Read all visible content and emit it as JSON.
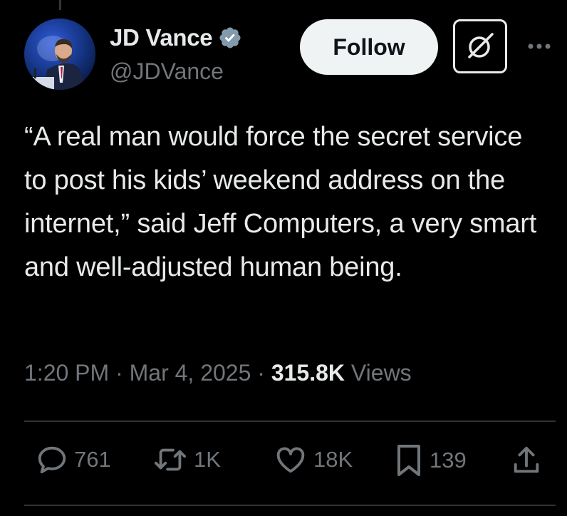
{
  "author": {
    "name": "JD Vance",
    "handle": "@JDVance",
    "verified": true,
    "verified_color": "#829aab"
  },
  "buttons": {
    "follow_label": "Follow"
  },
  "tweet": {
    "text": "“A real man would force the secret service to post his kids’ weekend address on the internet,” said Jeff Computers, a very smart and well-adjusted human being.",
    "time": "1:20 PM",
    "separator": " · ",
    "date": "Mar 4, 2025",
    "views_count": "315.8K",
    "views_label": "Views"
  },
  "actions": {
    "replies": "761",
    "reposts": "1K",
    "likes": "18K",
    "bookmarks": "139"
  },
  "icons": {
    "verified": "verified-badge-icon",
    "grok": "grok-icon",
    "more": "more-icon",
    "reply": "reply-icon",
    "repost": "repost-icon",
    "like": "heart-icon",
    "bookmark": "bookmark-icon",
    "share": "share-icon"
  },
  "colors": {
    "background": "#000000",
    "text_primary": "#e7e9ea",
    "text_secondary": "#71767b",
    "divider": "#2f3336"
  }
}
